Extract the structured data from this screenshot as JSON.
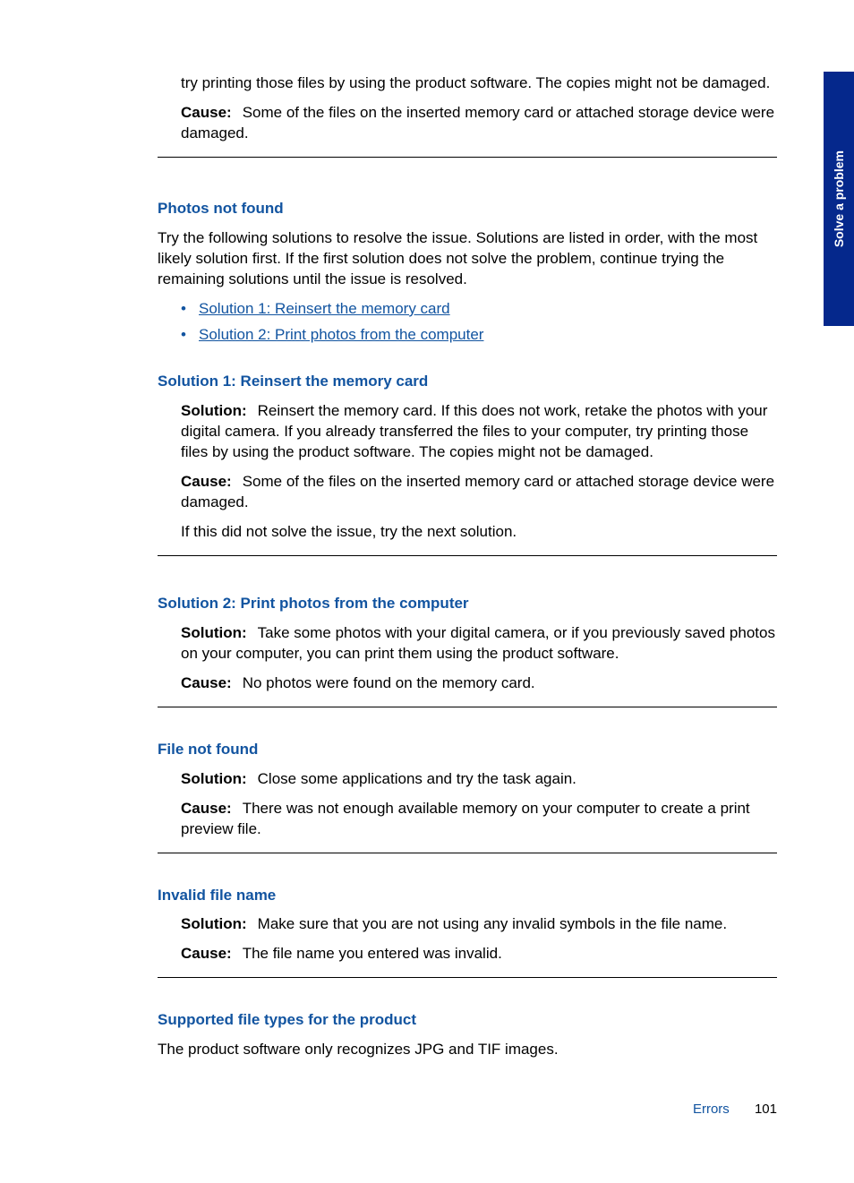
{
  "sideTab": "Solve a problem",
  "intro": {
    "p1": "try printing those files by using the product software. The copies might not be damaged.",
    "causeLabel": "Cause:",
    "causeText": "Some of the files on the inserted memory card or attached storage device were damaged."
  },
  "photosNotFound": {
    "heading": "Photos not found",
    "intro": "Try the following solutions to resolve the issue. Solutions are listed in order, with the most likely solution first. If the first solution does not solve the problem, continue trying the remaining solutions until the issue is resolved.",
    "link1": "Solution 1: Reinsert the memory card",
    "link2": "Solution 2: Print photos from the computer"
  },
  "sol1": {
    "heading": "Solution 1: Reinsert the memory card",
    "solLabel": "Solution:",
    "solText": "Reinsert the memory card. If this does not work, retake the photos with your digital camera. If you already transferred the files to your computer, try printing those files by using the product software. The copies might not be damaged.",
    "causeLabel": "Cause:",
    "causeText": "Some of the files on the inserted memory card or attached storage device were damaged.",
    "next": "If this did not solve the issue, try the next solution."
  },
  "sol2": {
    "heading": "Solution 2: Print photos from the computer",
    "solLabel": "Solution:",
    "solText": "Take some photos with your digital camera, or if you previously saved photos on your computer, you can print them using the product software.",
    "causeLabel": "Cause:",
    "causeText": "No photos were found on the memory card."
  },
  "fileNotFound": {
    "heading": "File not found",
    "solLabel": "Solution:",
    "solText": "Close some applications and try the task again.",
    "causeLabel": "Cause:",
    "causeText": "There was not enough available memory on your computer to create a print preview file."
  },
  "invalidFile": {
    "heading": "Invalid file name",
    "solLabel": "Solution:",
    "solText": "Make sure that you are not using any invalid symbols in the file name.",
    "causeLabel": "Cause:",
    "causeText": "The file name you entered was invalid."
  },
  "supported": {
    "heading": "Supported file types for the product",
    "text": "The product software only recognizes JPG and TIF images."
  },
  "footer": {
    "section": "Errors",
    "page": "101"
  }
}
